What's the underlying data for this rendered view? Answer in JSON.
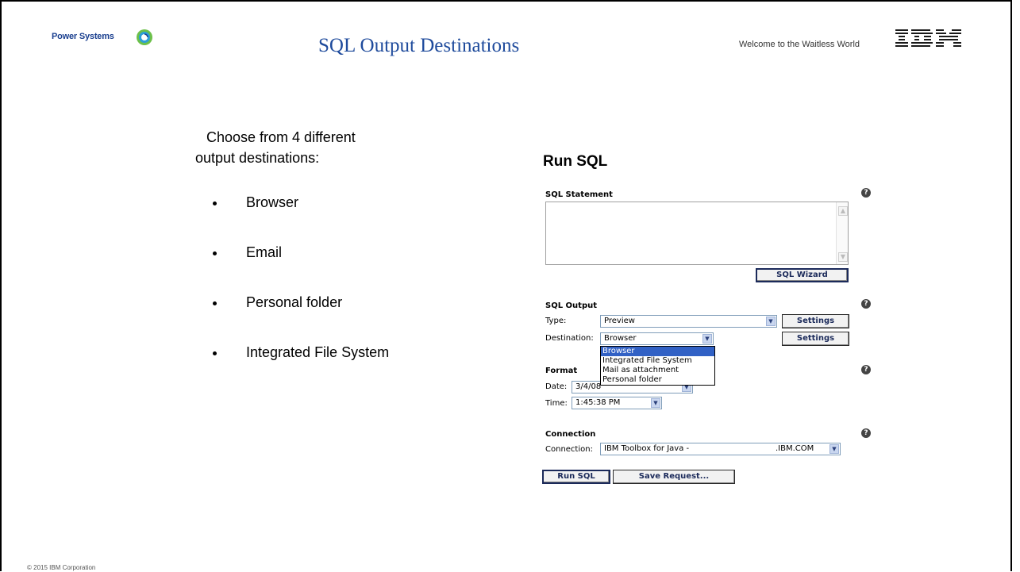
{
  "header": {
    "brand": "Power Systems",
    "title": "SQL Output Destinations",
    "welcome": "Welcome to the Waitless World",
    "ibm": "IBM"
  },
  "footer": {
    "copyright": "© 2015 IBM Corporation"
  },
  "intro": {
    "line1": "Choose from 4 different",
    "line2": "output destinations:"
  },
  "bullets": [
    "Browser",
    "Email",
    "Personal folder",
    "Integrated File System"
  ],
  "dialog": {
    "title": "Run SQL",
    "sql_statement_label": "SQL Statement",
    "sql_wizard": "SQL Wizard",
    "sql_output_label": "SQL Output",
    "type_label": "Type:",
    "type_value": "Preview",
    "destination_label": "Destination:",
    "destination_value": "Browser",
    "settings": "Settings",
    "destination_options": [
      "Browser",
      "Integrated File System",
      "Mail as attachment",
      "Personal folder"
    ],
    "format_label": "Format",
    "date_label": "Date:",
    "date_value": "3/4/08",
    "time_label": "Time:",
    "time_value": "1:45:38 PM",
    "connection_section": "Connection",
    "connection_label": "Connection:",
    "connection_value": "IBM Toolbox for Java -",
    "connection_suffix": ".IBM.COM",
    "run_sql": "Run SQL",
    "save_request": "Save Request...",
    "help_glyph": "?"
  }
}
